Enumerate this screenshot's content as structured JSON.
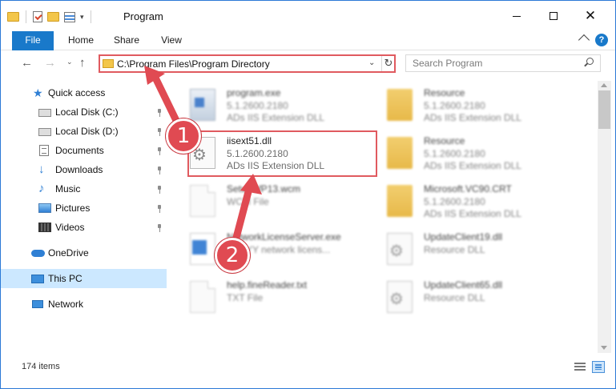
{
  "window": {
    "title": "Program",
    "controls": {
      "minimize": "",
      "maximize": "",
      "close": "✕"
    }
  },
  "ribbon": {
    "tabs": [
      "File",
      "Home",
      "Share",
      "View"
    ],
    "help": "?"
  },
  "address": {
    "path": "C:\\Program Files\\Program Directory",
    "search_placeholder": "Search Program",
    "refresh_symbol": "↻",
    "dropdown_symbol": "⌄"
  },
  "nav_buttons": {
    "back": "←",
    "forward": "→",
    "recent": "⌄",
    "up": "↑"
  },
  "sidebar": {
    "items": [
      {
        "label": "Quick access",
        "icon": "star-icon",
        "pinned": false
      },
      {
        "label": "Local Disk (C:)",
        "icon": "disk-icon",
        "pinned": true
      },
      {
        "label": "Local Disk (D:)",
        "icon": "disk-icon",
        "pinned": true
      },
      {
        "label": "Documents",
        "icon": "documents-icon",
        "pinned": true
      },
      {
        "label": "Downloads",
        "icon": "download-icon",
        "pinned": true
      },
      {
        "label": "Music",
        "icon": "music-icon",
        "pinned": true
      },
      {
        "label": "Pictures",
        "icon": "pictures-icon",
        "pinned": true
      },
      {
        "label": "Videos",
        "icon": "videos-icon",
        "pinned": true
      },
      {
        "label": "OneDrive",
        "icon": "cloud-icon",
        "pinned": false
      },
      {
        "label": "This PC",
        "icon": "computer-icon",
        "pinned": false,
        "selected": true
      },
      {
        "label": "Network",
        "icon": "network-icon",
        "pinned": false
      }
    ]
  },
  "files": [
    {
      "name": "program.exe",
      "line2": "5.1.2600.2180",
      "line3": "ADs IIS Extension DLL",
      "icon": "exe-icon",
      "blurred": true
    },
    {
      "name": "Resource",
      "line2": "5.1.2600.2180",
      "line3": "ADs IIS Extension DLL",
      "icon": "folder-icon",
      "blurred": true
    },
    {
      "name": "iisext51.dll",
      "line2": "5.1.2600.2180",
      "line3": "ADs IIS Extension DLL",
      "icon": "dll-gear-icon",
      "blurred": false
    },
    {
      "name": "Resource",
      "line2": "5.1.2600.2180",
      "line3": "ADs IIS Extension DLL",
      "icon": "folder-icon",
      "blurred": true
    },
    {
      "name": "SetupWP13.wcm",
      "line2": "WCM File",
      "line3": "",
      "icon": "document-icon",
      "blurred": true
    },
    {
      "name": "Microsoft.VC90.CRT",
      "line2": "5.1.2600.2180",
      "line3": "ADs IIS Extension DLL",
      "icon": "folder-icon",
      "blurred": true
    },
    {
      "name": "NetworkLicenseServer.exe",
      "line2": "ABBYY network licens...",
      "line3": "",
      "icon": "network-exe-icon",
      "blurred": true
    },
    {
      "name": "UpdateClient19.dll",
      "line2": "Resource DLL",
      "line3": "",
      "icon": "dll-gear-icon",
      "blurred": true
    },
    {
      "name": "help.fineReader.txt",
      "line2": "TXT File",
      "line3": "",
      "icon": "document-icon",
      "blurred": true
    },
    {
      "name": "UpdateClient65.dll",
      "line2": "Resource DLL",
      "line3": "",
      "icon": "dll-gear-icon",
      "blurred": true
    }
  ],
  "status": {
    "item_count": "174 items"
  },
  "annotations": {
    "badge1": "1",
    "badge2": "2",
    "color": "#e04a52"
  },
  "colors": {
    "accent": "#1979ca",
    "highlight": "#e05a5f",
    "selection": "#cce8ff"
  }
}
